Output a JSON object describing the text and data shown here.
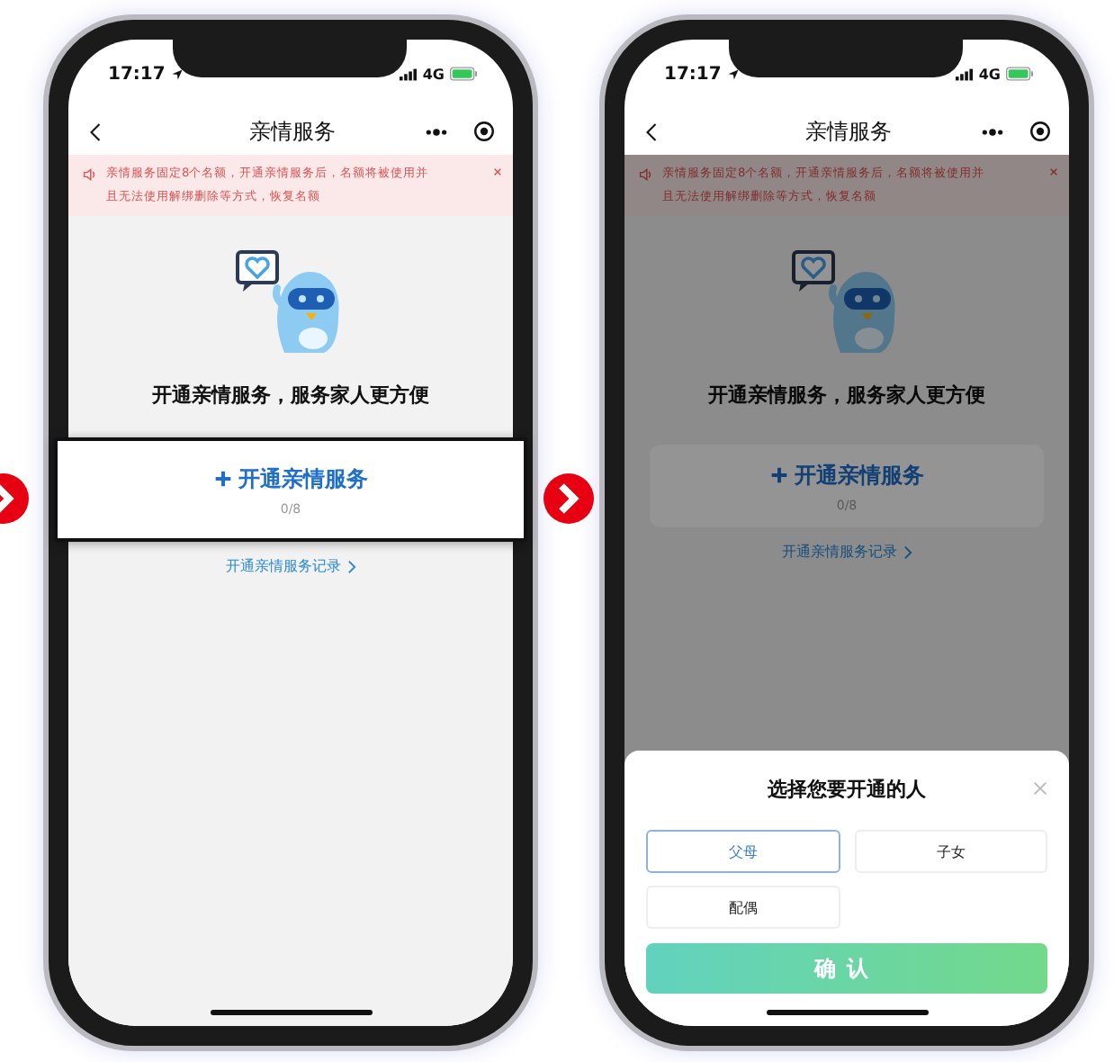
{
  "phones": [
    {
      "time": "17:17",
      "network": "4G",
      "title": "亲情服务",
      "notice": [
        "亲情服务固定8个名额，开通亲情服务后，名额将被使用并",
        "且无法使用解绑删除等方式，恢复名额"
      ],
      "headline": "开通亲情服务，服务家人更方便",
      "add_button": "开通亲情服务",
      "count": "0/8",
      "record_link": "开通亲情服务记录",
      "highlighted": true,
      "dimmed": false
    },
    {
      "time": "17:17",
      "network": "4G",
      "title": "亲情服务",
      "notice": [
        "亲情服务固定8个名额，开通亲情服务后，名额将被使用并",
        "且无法使用解绑删除等方式，恢复名额"
      ],
      "headline": "开通亲情服务，服务家人更方便",
      "add_button": "开通亲情服务",
      "count": "0/8",
      "record_link": "开通亲情服务记录",
      "highlighted": false,
      "dimmed": true,
      "sheet": {
        "title": "选择您要开通的人",
        "options": [
          {
            "label": "父母",
            "selected": true
          },
          {
            "label": "子女",
            "selected": false
          },
          {
            "label": "配偶",
            "selected": false
          }
        ],
        "confirm": "确认"
      }
    }
  ]
}
